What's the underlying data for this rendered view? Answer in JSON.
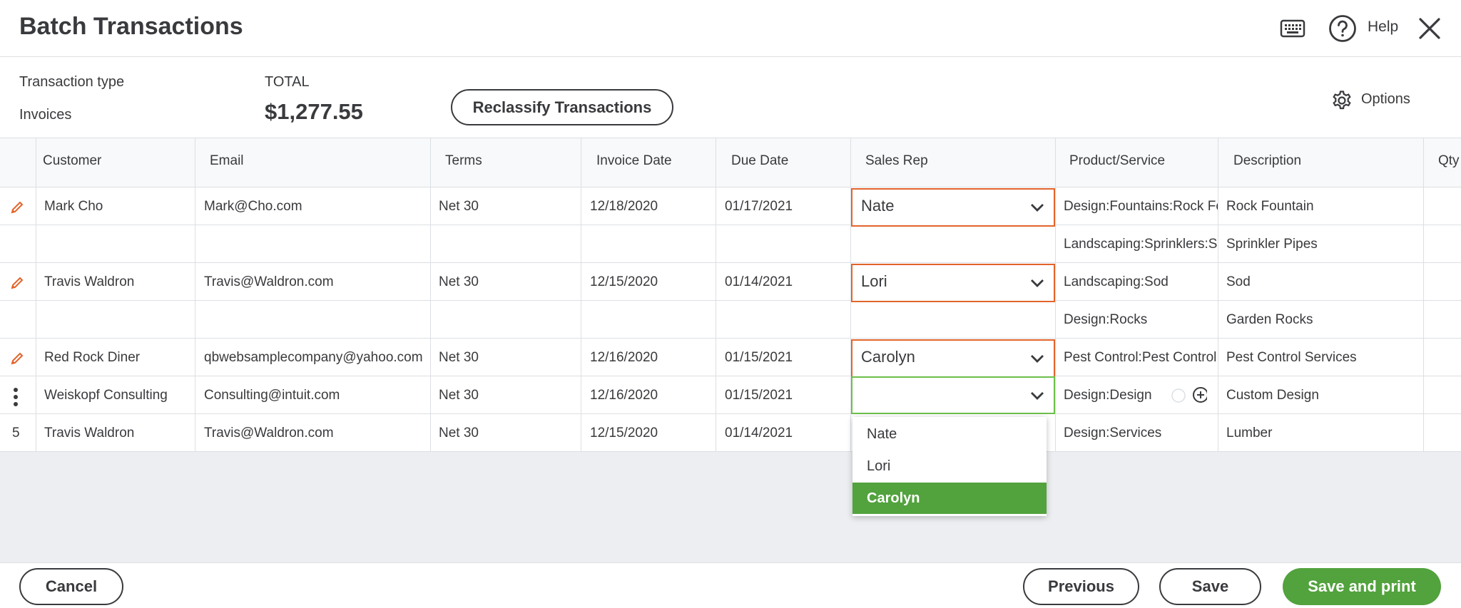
{
  "header": {
    "title": "Batch Transactions",
    "help_label": "Help"
  },
  "summary": {
    "transaction_type_label": "Transaction type",
    "transaction_type_value": "Invoices",
    "total_label": "TOTAL",
    "total_value": "$1,277.55",
    "reclassify_label": "Reclassify Transactions",
    "options_label": "Options"
  },
  "table": {
    "columns": [
      "Customer",
      "Email",
      "Terms",
      "Invoice Date",
      "Due Date",
      "Sales Rep",
      "Product/Service",
      "Description",
      "Qty"
    ],
    "rows": [
      {
        "customer": "Mark Cho",
        "email": "Mark@Cho.com",
        "terms": "Net 30",
        "invoice_date": "12/18/2020",
        "due_date": "01/17/2021",
        "sales_rep": "Nate",
        "product": "Design:Fountains:Rock Fountain",
        "description": "Rock Fountain"
      },
      {
        "customer": "",
        "email": "",
        "terms": "",
        "invoice_date": "",
        "due_date": "",
        "sales_rep": "",
        "product": "Landscaping:Sprinklers:Sprinkler Pipes",
        "description": "Sprinkler Pipes"
      },
      {
        "customer": "Travis Waldron",
        "email": "Travis@Waldron.com",
        "terms": "Net 30",
        "invoice_date": "12/15/2020",
        "due_date": "01/14/2021",
        "sales_rep": "Lori",
        "product": "Landscaping:Sod",
        "description": "Sod"
      },
      {
        "customer": "",
        "email": "",
        "terms": "",
        "invoice_date": "",
        "due_date": "",
        "sales_rep": "",
        "product": "Design:Rocks",
        "description": "Garden Rocks"
      },
      {
        "customer": "Red Rock Diner",
        "email": "qbwebsamplecompany@yahoo.com",
        "terms": "Net 30",
        "invoice_date": "12/16/2020",
        "due_date": "01/15/2021",
        "sales_rep": "Carolyn",
        "product": "Pest Control:Pest Control",
        "description": "Pest Control Services"
      },
      {
        "customer": "Weiskopf Consulting",
        "email": "Consulting@intuit.com",
        "terms": "Net 30",
        "invoice_date": "12/16/2020",
        "due_date": "01/15/2021",
        "sales_rep": "",
        "product": "Design:Design",
        "description": "Custom Design"
      },
      {
        "row_number": "5",
        "customer": "Travis Waldron",
        "email": "Travis@Waldron.com",
        "terms": "Net 30",
        "invoice_date": "12/15/2020",
        "due_date": "01/14/2021",
        "sales_rep": "",
        "product": "Design:Services",
        "description": "Lumber"
      }
    ]
  },
  "dropdown": {
    "options": [
      "Nate",
      "Lori",
      "Carolyn"
    ],
    "highlighted": "Carolyn"
  },
  "footer": {
    "cancel_label": "Cancel",
    "previous_label": "Previous",
    "save_label": "Save",
    "save_print_label": "Save and print"
  },
  "colors": {
    "accent_green": "#52a23d",
    "edited_border": "#e3642b",
    "focus_border": "#6cc04a",
    "text": "#393a3d",
    "grid_line": "#dcdfe3",
    "empty_area": "#eceef1"
  },
  "icons": [
    "keyboard-icon",
    "help-icon",
    "close-icon",
    "gear-icon",
    "pencil-icon",
    "kebab-menu-icon",
    "chevron-down-icon",
    "add-circle-icon"
  ]
}
